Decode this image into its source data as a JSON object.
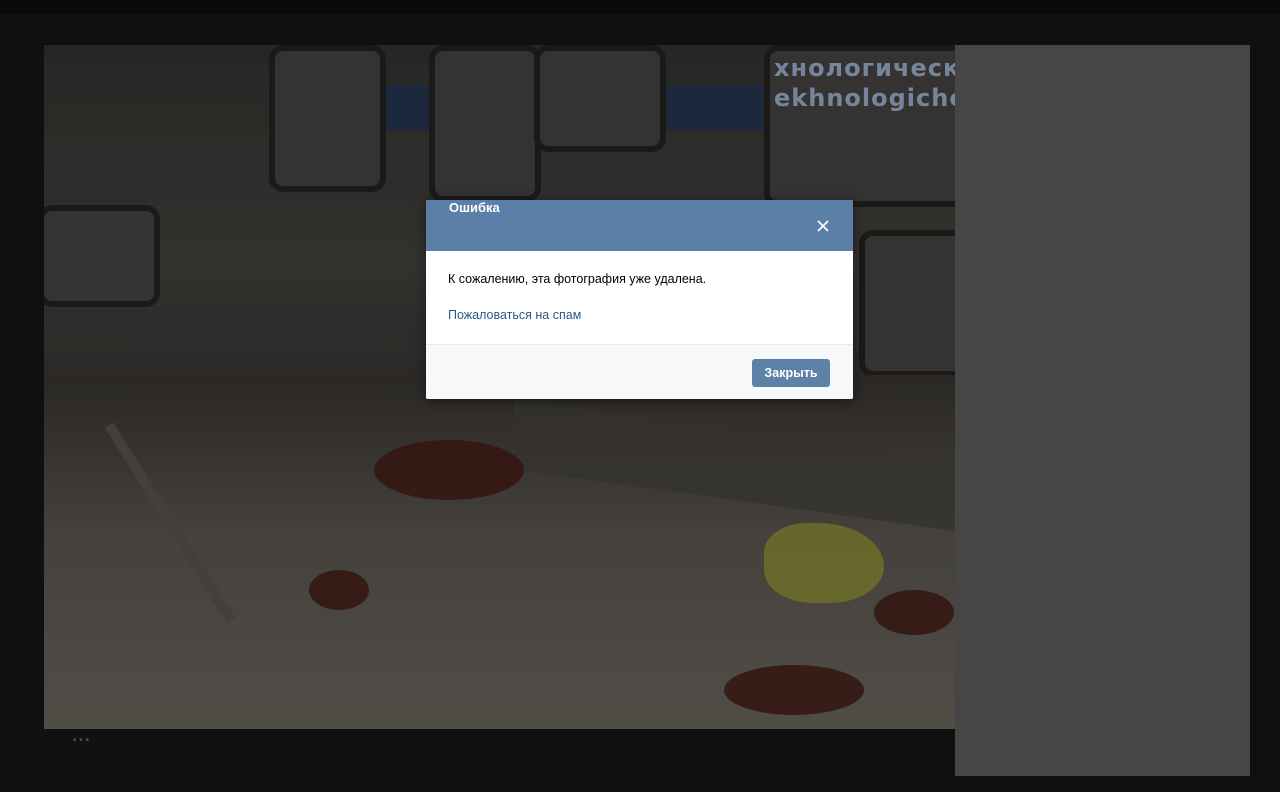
{
  "modal": {
    "title": "Ошибка",
    "message": "К сожалению, эта фотография уже удалена.",
    "report_link": "Пожаловаться на спам",
    "close_button": "Закрыть",
    "close_icon": "close-icon",
    "header_color": "#5b7fa6",
    "button_color": "#5e81a8",
    "link_color": "#2a5885"
  },
  "viewer": {
    "more_label": "...",
    "sidebar_color": "#4e4e4e"
  },
  "photo": {
    "sign_text_cyrillic": "хнологическ",
    "sign_text_latin": "ekhnologichesk"
  }
}
